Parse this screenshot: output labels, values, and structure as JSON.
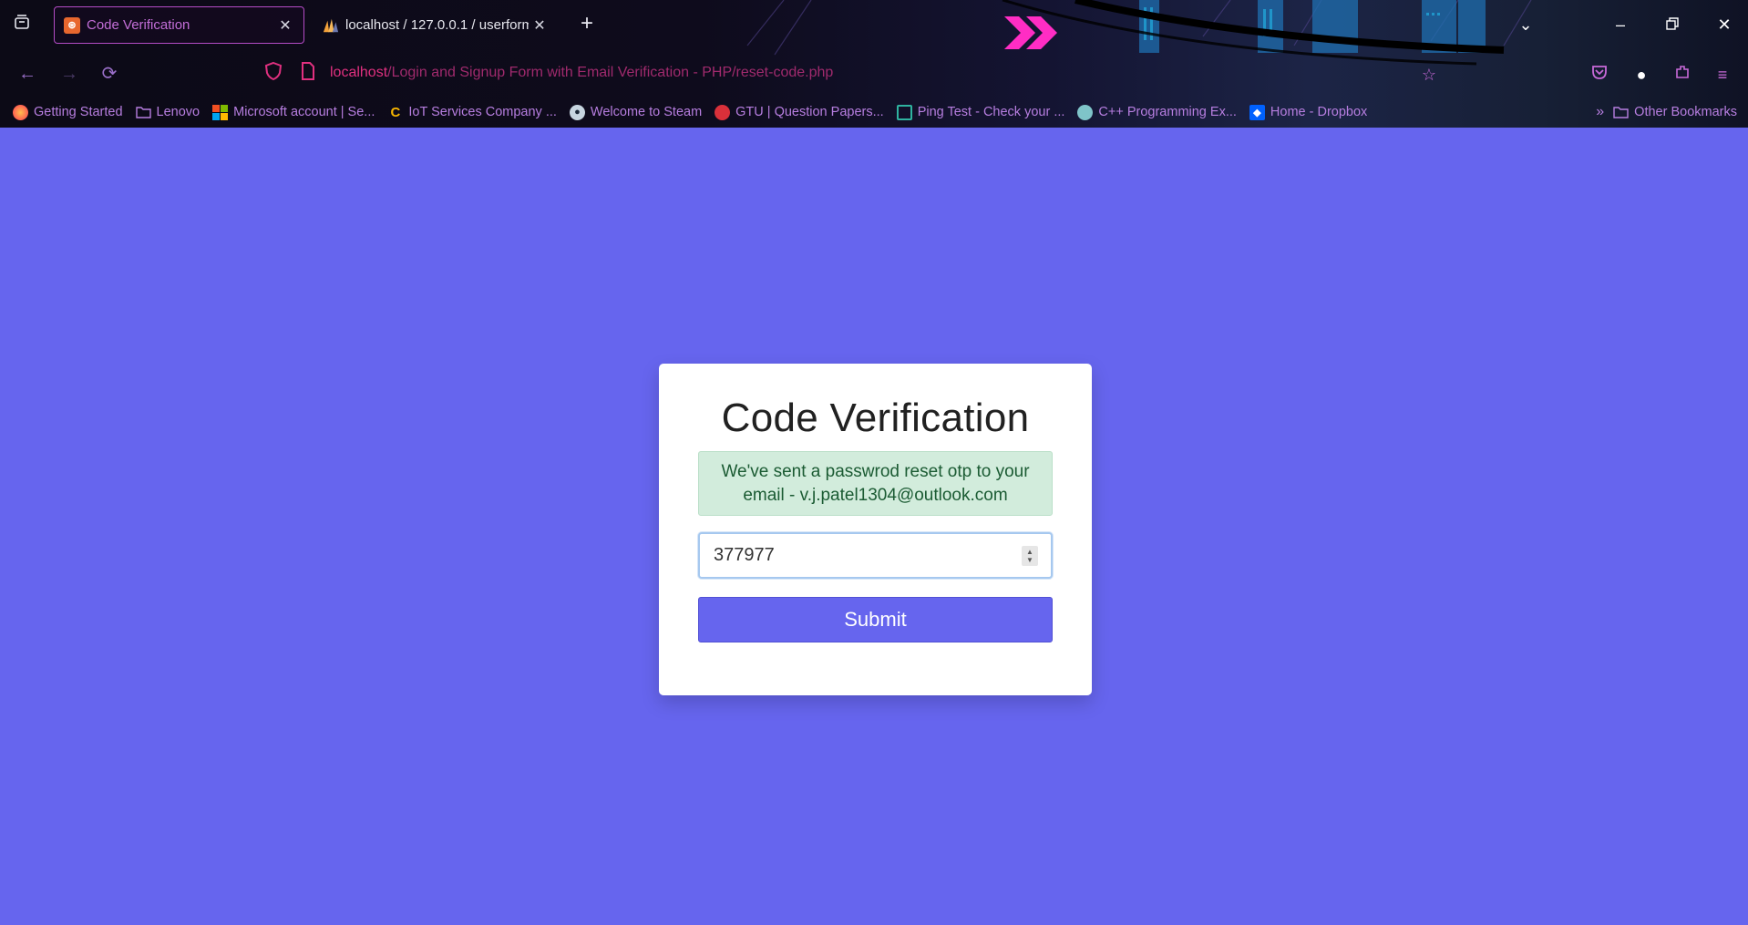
{
  "browser": {
    "tabs": [
      {
        "title": "Code Verification",
        "active": true,
        "favicon": "xampp-icon",
        "favicon_color": "#e8672e"
      },
      {
        "title": "localhost / 127.0.0.1 / userform",
        "active": false,
        "favicon": "phpmyadmin-icon",
        "favicon_color": "#f4a23a"
      }
    ],
    "url": {
      "host": "localhost",
      "path": "/Login and Signup Form with Email Verification - PHP/reset-code.php"
    },
    "bookmarks": [
      {
        "label": "Getting Started",
        "icon": "firefox-icon",
        "color": "#ff7139"
      },
      {
        "label": "Lenovo",
        "icon": "folder-icon",
        "color": "#b77ee0"
      },
      {
        "label": "Microsoft account | Se...",
        "icon": "microsoft-icon",
        "color": "#f25022"
      },
      {
        "label": "IoT Services Company ...",
        "icon": "c-logo-icon",
        "color": "#f7b500"
      },
      {
        "label": "Welcome to Steam",
        "icon": "steam-icon",
        "color": "#c7d5e0"
      },
      {
        "label": "GTU | Question Papers...",
        "icon": "gtu-icon",
        "color": "#d9303a"
      },
      {
        "label": "Ping Test - Check your ...",
        "icon": "ping-icon",
        "color": "#2fb3a0"
      },
      {
        "label": "C++ Programming Ex...",
        "icon": "cpp-icon",
        "color": "#7fc4c9"
      },
      {
        "label": "Home - Dropbox",
        "icon": "dropbox-icon",
        "color": "#0061fe"
      }
    ],
    "other_bookmarks": "Other Bookmarks",
    "accent": "#c36ed7"
  },
  "page": {
    "background": "#6665ee",
    "title": "Code Verification",
    "alert_message": "We've sent a passwrod reset otp to your email - v.j.patel1304@outlook.com",
    "otp_value": "377977",
    "submit_label": "Submit"
  }
}
